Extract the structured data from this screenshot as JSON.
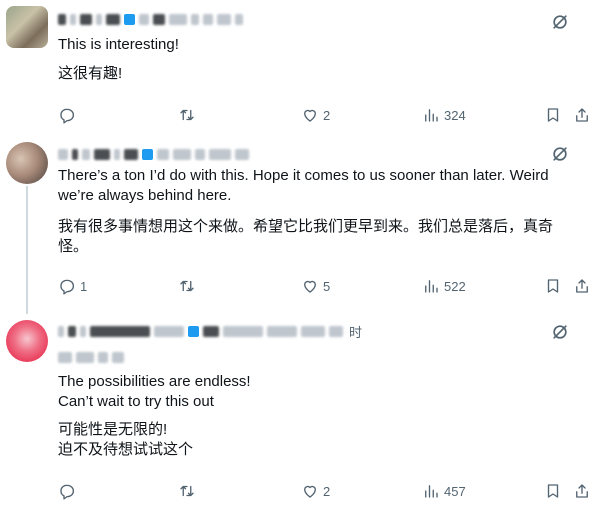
{
  "replies": [
    {
      "text_en": "This is interesting!",
      "text_zh": "这很有趣!",
      "replies_count": "",
      "retweets_count": "",
      "likes_count": "2",
      "views_count": "324"
    },
    {
      "text_en": "There’s a ton I’d do with this. Hope it comes to us sooner than later. Weird\nwe’re always behind here.",
      "text_zh": "我有很多事情想用这个来做。希望它比我们更早到来。我们总是落后，真奇\n怪。",
      "replies_count": "1",
      "retweets_count": "",
      "likes_count": "5",
      "views_count": "522"
    },
    {
      "time_suffix": "时",
      "text_en": "The possibilities are endless!\nCan’t wait to try this out",
      "text_zh": "可能性是无限的!\n迫不及待想试试这个",
      "replies_count": "",
      "retweets_count": "",
      "likes_count": "2",
      "views_count": "457"
    }
  ],
  "icons": {
    "reply": "reply-icon",
    "retweet": "retweet-icon",
    "like": "heart-icon",
    "views": "views-icon",
    "bookmark": "bookmark-icon",
    "share": "share-icon",
    "grok": "grok-icon"
  },
  "colors": {
    "text": "#0f1419",
    "secondary": "#536471",
    "verified": "#1d9bf0",
    "thread_line": "#cfd9de"
  }
}
